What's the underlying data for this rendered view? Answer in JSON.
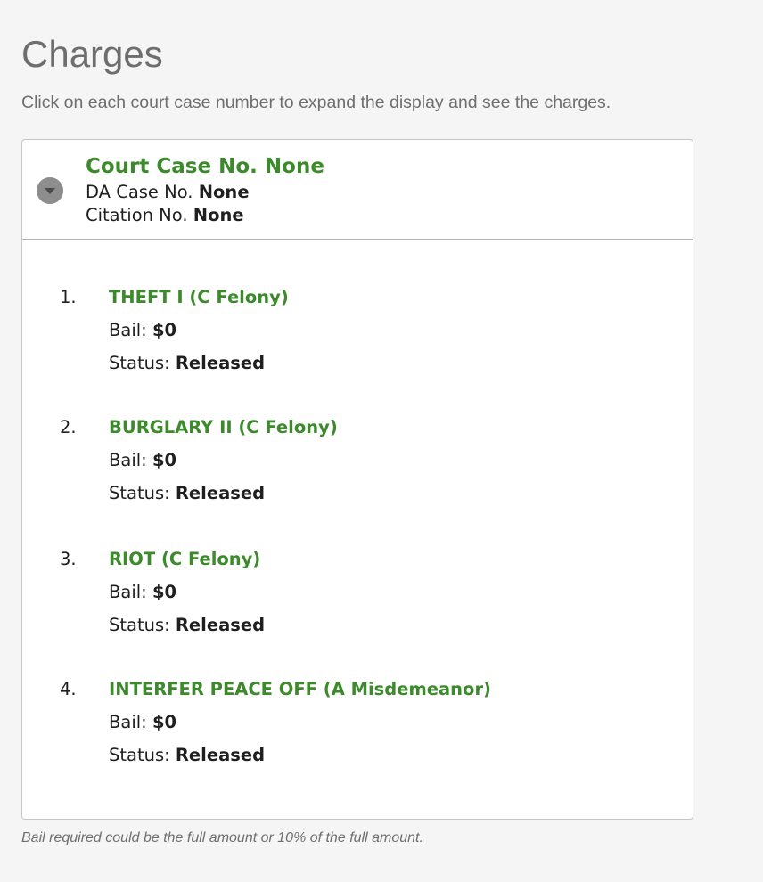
{
  "page": {
    "title": "Charges",
    "intro": "Click on each court case number to expand the display and see the charges.",
    "footnote": "Bail required could be the full amount or 10% of the full amount."
  },
  "case": {
    "toggle_icon": "collapse-triangle-icon",
    "court_case_label": "Court Case No.",
    "court_case_value": "None",
    "da_case_label": "DA Case No.",
    "da_case_value": "None",
    "citation_label": "Citation No.",
    "citation_value": "None"
  },
  "charges": [
    {
      "number": "1.",
      "name": "THEFT I (C Felony)",
      "bail_label": "Bail:",
      "bail": "$0",
      "status_label": "Status:",
      "status": "Released"
    },
    {
      "number": "2.",
      "name": "BURGLARY II (C Felony)",
      "bail_label": "Bail:",
      "bail": "$0",
      "status_label": "Status:",
      "status": "Released"
    },
    {
      "number": "3.",
      "name": "RIOT (C Felony)",
      "bail_label": "Bail:",
      "bail": "$0",
      "status_label": "Status:",
      "status": "Released"
    },
    {
      "number": "4.",
      "name": "INTERFER PEACE OFF (A Misdemeanor)",
      "bail_label": "Bail:",
      "bail": "$0",
      "status_label": "Status:",
      "status": "Released"
    }
  ],
  "colors": {
    "accent_green": "#3c8a2c",
    "muted_text": "#6e6e6e",
    "body_text": "#1f1f1f",
    "panel_border": "#c6c6c6",
    "toggle_circle": "#8d8d8d"
  }
}
